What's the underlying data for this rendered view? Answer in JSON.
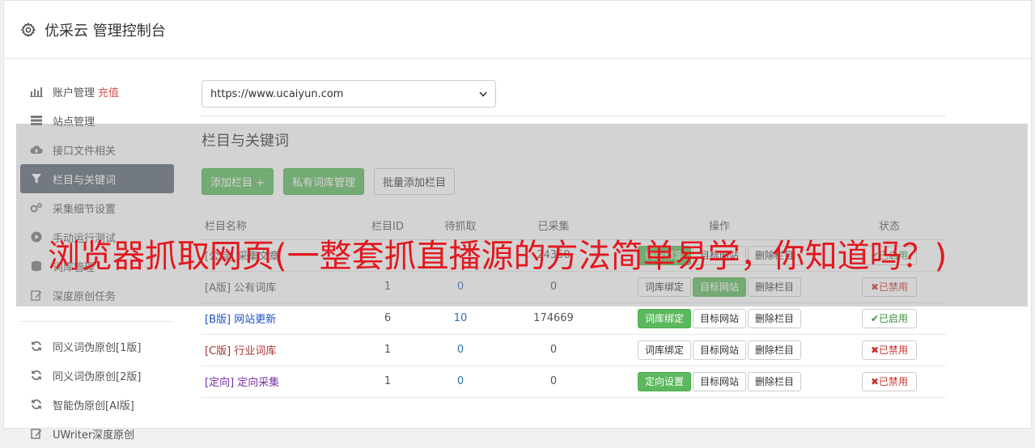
{
  "app": {
    "title": "优采云 管理控制台"
  },
  "sidebar": {
    "items": [
      {
        "icon": "bar-chart-icon",
        "label": "账户管理",
        "extra": "充值"
      },
      {
        "icon": "server-icon",
        "label": "站点管理"
      },
      {
        "icon": "cloud-upload-icon",
        "label": "接口文件相关"
      },
      {
        "icon": "filter-icon",
        "label": "栏目与关键词",
        "active": true
      },
      {
        "icon": "cogs-icon",
        "label": "采集细节设置"
      },
      {
        "icon": "play-icon",
        "label": "手动运行测试"
      },
      {
        "icon": "database-icon",
        "label": "词库管理"
      },
      {
        "icon": "edit-icon",
        "label": "深度原创任务"
      }
    ],
    "tools": [
      {
        "icon": "refresh-icon",
        "label": "同义词伪原创[1版]"
      },
      {
        "icon": "refresh-icon",
        "label": "同义词伪原创[2版]"
      },
      {
        "icon": "refresh-icon",
        "label": "智能伪原创[AI版]"
      },
      {
        "icon": "edit-icon",
        "label": "UWriter深度原创"
      }
    ]
  },
  "site_select": {
    "value": "https://www.ucaiyun.com"
  },
  "section": {
    "title": "栏目与关键词"
  },
  "toolbar": {
    "add": "添加栏目 +",
    "private_lib": "私有词库管理",
    "batch_add": "批量添加栏目"
  },
  "table": {
    "headers": [
      "栏目名称",
      "栏目ID",
      "待抓取",
      "已采集",
      "操作",
      "状态"
    ],
    "rows": [
      {
        "type": "[公有]",
        "name": "采集文章",
        "id": "",
        "pending": "",
        "collected": "24350",
        "op1": "词库绑定",
        "op2": "目标网站",
        "op3": "删除栏目",
        "status": "已启用",
        "on": true,
        "typeclass": "type-a",
        "op1green": true
      },
      {
        "type": "[A版]",
        "name": "公有词库",
        "id": "1",
        "pending": "0",
        "collected": "0",
        "op1": "词库绑定",
        "op2": "目标网站",
        "op3": "删除栏目",
        "status": "已禁用",
        "on": false,
        "typeclass": "type-a",
        "op2green": true
      },
      {
        "type": "[B版]",
        "name": "网站更新",
        "id": "6",
        "pending": "10",
        "collected": "174669",
        "op1": "词库绑定",
        "op2": "目标网站",
        "op3": "删除栏目",
        "status": "已启用",
        "on": true,
        "typeclass": "type-b",
        "op1green": true
      },
      {
        "type": "[C版]",
        "name": "行业词库",
        "id": "1",
        "pending": "0",
        "collected": "0",
        "op1": "词库绑定",
        "op2": "目标网站",
        "op3": "删除栏目",
        "status": "已禁用",
        "on": false,
        "typeclass": "type-c"
      },
      {
        "type": "[定向]",
        "name": "定向采集",
        "id": "1",
        "pending": "0",
        "collected": "0",
        "op1": "定向设置",
        "op2": "目标网站",
        "op3": "删除栏目",
        "status": "已禁用",
        "on": false,
        "typeclass": "type-d",
        "op1green": true
      }
    ]
  },
  "overlay": {
    "headline": "浏览器抓取网页(一整套抓直播源的方法简单易学，你知道吗？)"
  },
  "colors": {
    "accent_green": "#5cb85c",
    "active_nav": "#5b6470",
    "danger": "#d9534f",
    "headline_red": "#e3171e"
  }
}
